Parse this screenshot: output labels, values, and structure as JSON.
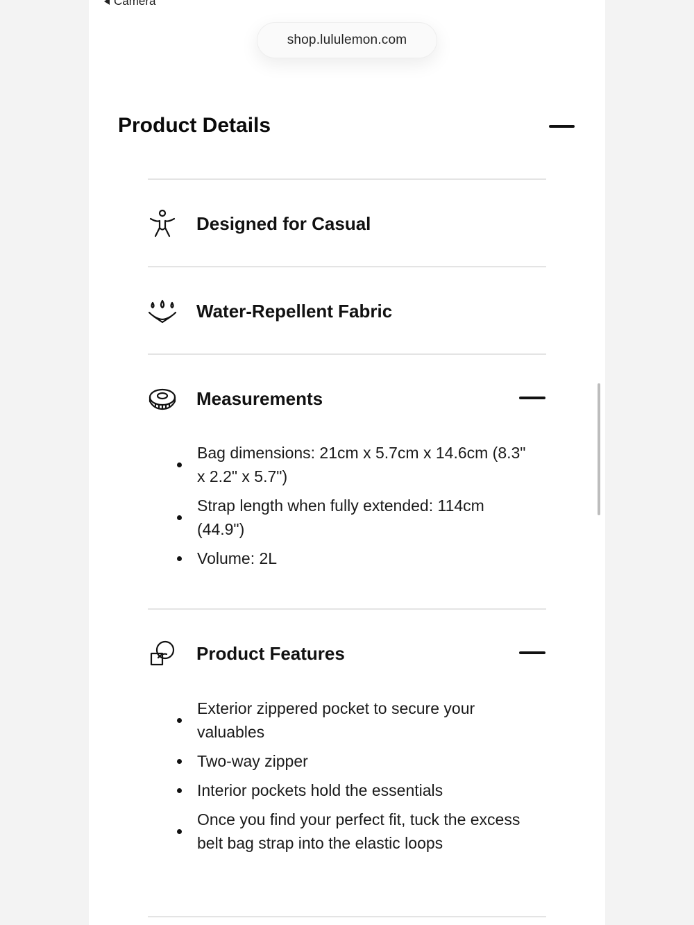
{
  "browser": {
    "back_label": "Camera",
    "url": "shop.lululemon.com"
  },
  "product_details": {
    "title": "Product Details"
  },
  "sections": [
    {
      "label": "Designed for Casual",
      "icon": "person-stretch-icon"
    },
    {
      "label": "Water-Repellent Fabric",
      "icon": "water-drops-icon"
    },
    {
      "label": "Measurements",
      "icon": "measuring-tape-icon",
      "items": [
        "Bag dimensions: 21cm x 5.7cm x 14.6cm (8.3\" x 2.2\" x 5.7\")",
        "Strap length when fully extended: 114cm (44.9\")",
        "Volume: 2L"
      ]
    },
    {
      "label": "Product Features",
      "icon": "features-circles-icon",
      "items": [
        "Exterior zippered pocket to secure your valuables",
        "Two-way zipper",
        "Interior pockets hold the essentials",
        "Once you find your perfect fit, tuck the excess belt bag strap into the elastic loops"
      ]
    }
  ]
}
